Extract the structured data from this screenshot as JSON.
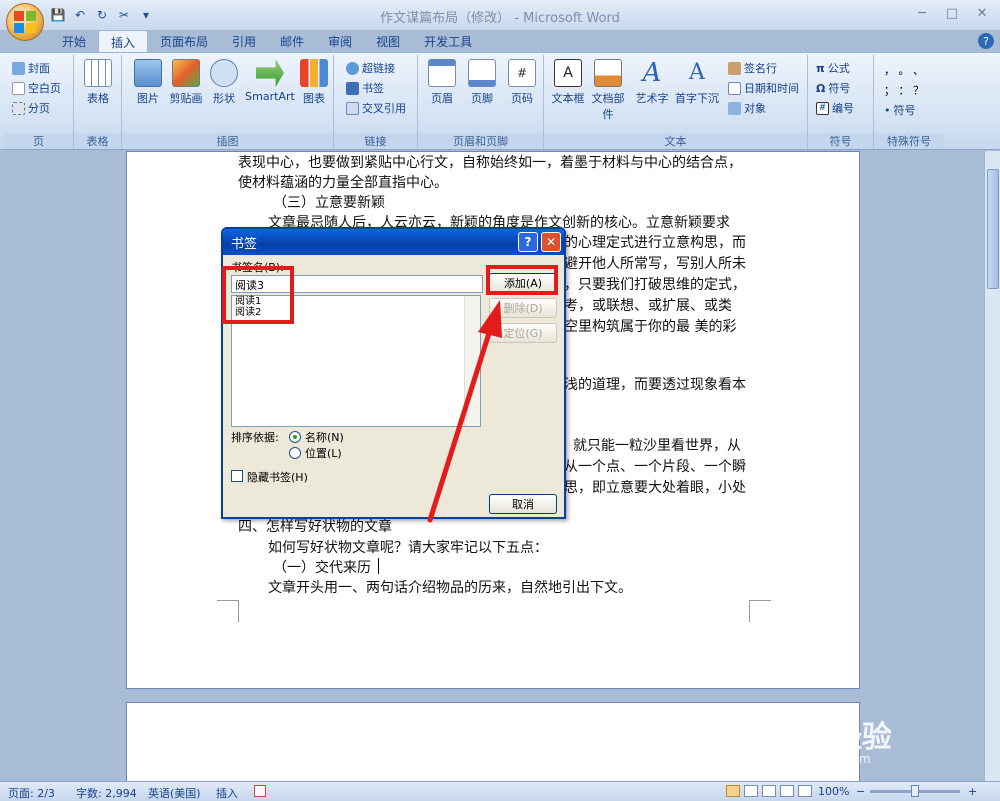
{
  "window": {
    "title": "作文谋篇布局（修改） - Microsoft Word"
  },
  "qat": {
    "save_icon": "💾",
    "undo_icon": "↶",
    "redo_icon": "↻",
    "format_icon": "✂",
    "more_icon": "▾"
  },
  "tabs": [
    "开始",
    "插入",
    "页面布局",
    "引用",
    "邮件",
    "审阅",
    "视图",
    "开发工具"
  ],
  "ribbon": {
    "pages": {
      "label": "页",
      "cover": "封面",
      "blank": "空白页",
      "break": "分页"
    },
    "tables": {
      "label": "表格",
      "table": "表格"
    },
    "illustrations": {
      "label": "插图",
      "picture": "图片",
      "clipart": "剪贴画",
      "shapes": "形状",
      "smartart": "SmartArt",
      "chart": "图表"
    },
    "links": {
      "label": "链接",
      "hyperlink": "超链接",
      "bookmark": "书签",
      "crossref": "交叉引用"
    },
    "headerfooter": {
      "label": "页眉和页脚",
      "header": "页眉",
      "footer": "页脚",
      "pagenum": "页码"
    },
    "text": {
      "label": "文本",
      "textbox": "文本框",
      "quickparts": "文档部件",
      "wordart": "艺术字",
      "dropcap": "首字下沉",
      "signature": "签名行",
      "datetime": "日期和时间",
      "object": "对象"
    },
    "symbols": {
      "label": "符号",
      "equation": "公式",
      "symbol": "符号",
      "numbering": "编号"
    },
    "special": {
      "label": "特殊符号",
      "r1": "，  。  、",
      "r2": "；  ：  ？",
      "r3": "符号"
    }
  },
  "document": {
    "lines": [
      "表现中心，也要做到紧贴中心行文，自称始终如一，着墨于材料与中心的结合点，",
      "使材料蕴涵的力量全部直指中心。",
      "（三）立意要新颖",
      "文章最忌随人后，人云亦云，新颖的角度是作文创新的核心。立意新颖要求",
      "的心理定式进行立意构思，而",
      "避开他人所常写，写别人所未",
      "，只要我们打破思维的定式，",
      "考，或联想、或扩展、或类",
      "空里构筑属于你的最 美的彩",
      "浅的道理，而要透过现象看本",
      "就只能一粒沙里看世界，从",
      "从一个点、一个片段、一个瞬",
      "思，即立意要大处着眼，小处",
      "四、怎样写好状物的文章",
      "如何写好状物文章呢？请大家牢记以下五点：",
      "（一）交代来历",
      "文章开头用一、两句话介绍物品的历来，自然地引出下文。"
    ]
  },
  "dialog": {
    "title": "书签",
    "name_label": "书签名(B):",
    "name_value": "阅读3",
    "items": [
      "阅读1",
      "阅读2"
    ],
    "add": "添加(A)",
    "delete": "删除(D)",
    "goto": "定位(G)",
    "sort_label": "排序依据:",
    "sort_name": "名称(N)",
    "sort_location": "位置(L)",
    "hidden": "隐藏书签(H)",
    "cancel": "取消"
  },
  "status": {
    "page": "页面: 2/3",
    "words": "字数: 2,994",
    "language": "英语(美国)",
    "mode": "插入",
    "zoom": "100%",
    "zoom_out": "−",
    "zoom_in": "+"
  },
  "watermark": {
    "brand": "Bai 经验",
    "url": "jingyan.baidu.com"
  },
  "colors": {
    "highlight": "#e41b1b",
    "dialog_title": "#0740a8"
  }
}
